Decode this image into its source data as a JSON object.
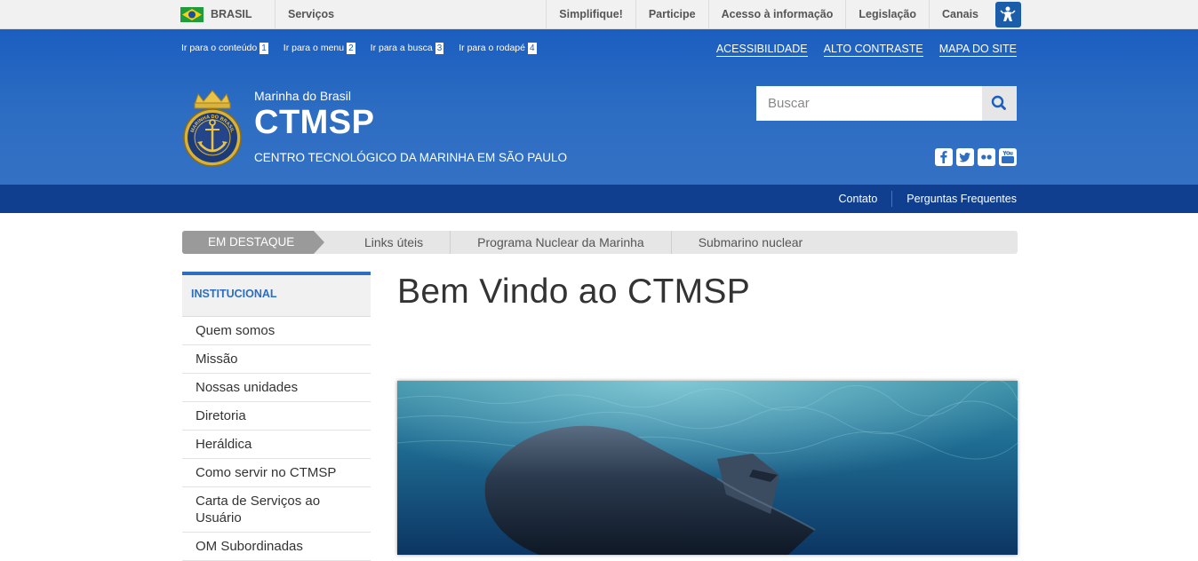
{
  "govbar": {
    "country": "BRASIL",
    "services": "Serviços",
    "links": [
      "Simplifique!",
      "Participe",
      "Acesso à informação",
      "Legislação",
      "Canais"
    ]
  },
  "skip_links": [
    {
      "label": "Ir para o conteúdo",
      "num": "1"
    },
    {
      "label": "Ir para o menu",
      "num": "2"
    },
    {
      "label": "Ir para a busca",
      "num": "3"
    },
    {
      "label": "Ir para o rodapé",
      "num": "4"
    }
  ],
  "access_links": [
    "ACESSIBILIDADE",
    "ALTO CONTRASTE",
    "MAPA DO SITE"
  ],
  "header": {
    "subtitle": "Marinha do Brasil",
    "title": "CTMSP",
    "description": "CENTRO TECNOLÓGICO DA MARINHA EM SÃO PAULO",
    "logo_text": "MARINHA DO BRASIL"
  },
  "search": {
    "placeholder": "Buscar"
  },
  "social": [
    "facebook-icon",
    "twitter-icon",
    "flickr-icon",
    "youtube-icon"
  ],
  "service_bar": [
    "Contato",
    "Perguntas Frequentes"
  ],
  "highlights": {
    "label": "EM DESTAQUE",
    "links": [
      "Links úteis",
      "Programa Nuclear da Marinha",
      "Submarino nuclear"
    ]
  },
  "sidebar": {
    "heading": "INSTITUCIONAL",
    "items": [
      "Quem somos",
      "Missão",
      "Nossas unidades",
      "Diretoria",
      "Heráldica",
      "Como servir no CTMSP",
      "Carta de Serviços ao Usuário",
      "OM Subordinadas"
    ]
  },
  "main": {
    "title": "Bem Vindo ao CTMSP"
  },
  "colors": {
    "header_blue": "#2d6dc2",
    "service_bar": "#0f3f8e",
    "accent": "#2d6dc2"
  }
}
